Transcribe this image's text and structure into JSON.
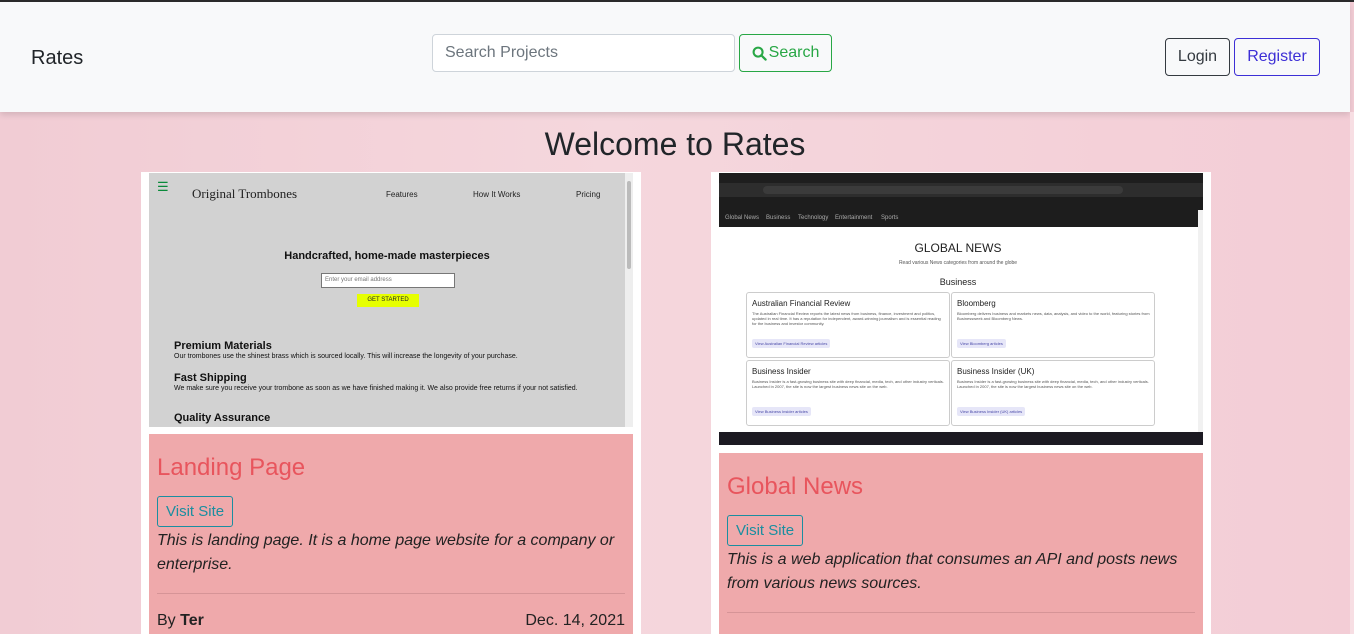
{
  "navbar": {
    "brand": "Rates",
    "search_placeholder": "Search Projects",
    "search_label": "Search",
    "login_label": "Login",
    "register_label": "Register"
  },
  "main": {
    "heading": "Welcome to Rates"
  },
  "projects": [
    {
      "title": "Landing Page",
      "visit_label": "Visit Site",
      "description": "This is landing page. It is a home page website for a company or enterprise.",
      "by_label": "By",
      "author": "Ter",
      "date": "Dec. 14, 2021",
      "preview": {
        "logo": "Original Trombones",
        "nav": [
          "Features",
          "How It Works",
          "Pricing"
        ],
        "headline": "Handcrafted, home-made masterpieces",
        "email_placeholder": "Enter your email address",
        "cta": "GET STARTED",
        "sections": [
          {
            "title": "Premium Materials",
            "text": "Our trombones use the shinest brass which is sourced locally. This will increase the longevity of your purchase."
          },
          {
            "title": "Fast Shipping",
            "text": "We make sure you receive your trombone as soon as we have finished making it. We also provide free returns if your not satisfied."
          },
          {
            "title": "Quality Assurance",
            "text": ""
          }
        ]
      }
    },
    {
      "title": "Global News",
      "visit_label": "Visit Site",
      "description": "This is a web application that consumes an API and posts news from various news sources.",
      "preview": {
        "nav": [
          "Global News",
          "Business",
          "Technology",
          "Entertainment",
          "Sports"
        ],
        "title": "GLOBAL NEWS",
        "subtitle": "Read various News categories from around the globe",
        "section": "Business",
        "sources": [
          {
            "name": "Australian Financial Review",
            "text": "The Australian Financial Review reports the latest news from business, finance, investment and politics, updated in real time. It has a reputation for independent, award-winning journalism and is essential reading for the business and investor community.",
            "link": "View Australian Financial Review articles"
          },
          {
            "name": "Bloomberg",
            "text": "Bloomberg delivers business and markets news, data, analysis, and video to the world, featuring stories from Businessweek and Bloomberg News.",
            "link": "View Bloomberg articles"
          },
          {
            "name": "Business Insider",
            "text": "Business Insider is a fast-growing business site with deep financial, media, tech, and other industry verticals. Launched in 2007, the site is now the largest business news site on the web.",
            "link": "View Business Insider articles"
          },
          {
            "name": "Business Insider (UK)",
            "text": "Business Insider is a fast-growing business site with deep financial, media, tech, and other industry verticals. Launched in 2007, the site is now the largest business news site on the web.",
            "link": "View Business Insider (UK) articles"
          }
        ]
      }
    }
  ]
}
